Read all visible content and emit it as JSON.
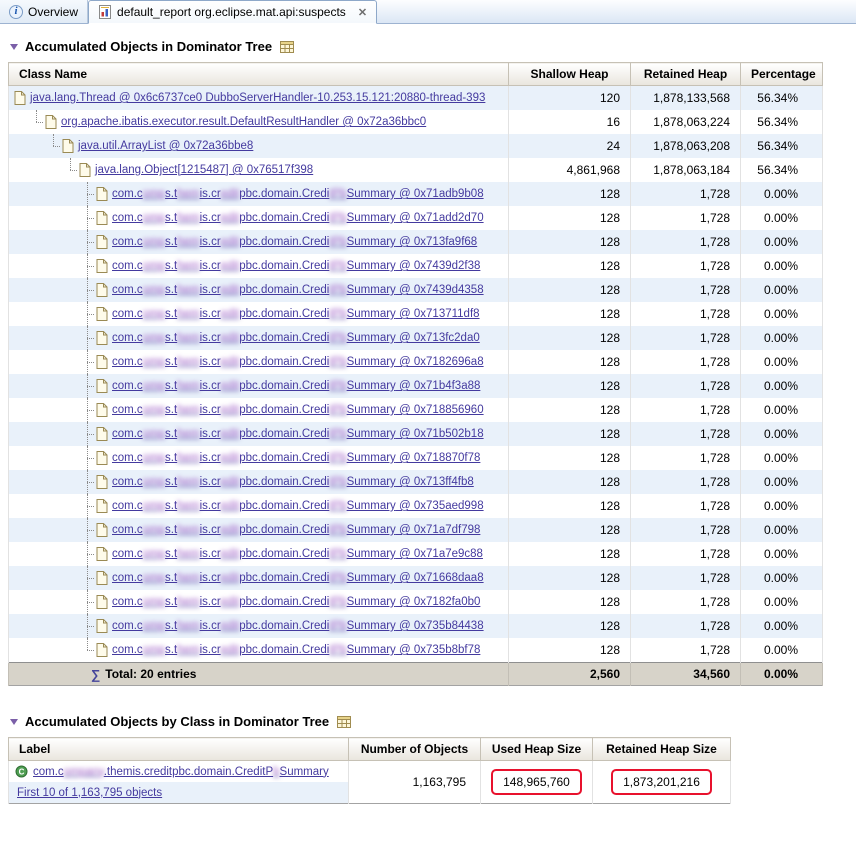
{
  "colors": {
    "link": "#443a9f",
    "redacted": "#9b58c4",
    "annotation_red": "#e8112d",
    "row_alt": "#e9f1fa",
    "total_bg": "#d7d3c9"
  },
  "tabs": [
    {
      "label": "Overview",
      "icon": "info-icon"
    },
    {
      "label": "default_report org.eclipse.mat.api:suspects",
      "icon": "report-icon",
      "active": true,
      "closable": true
    }
  ],
  "dominator_tree": {
    "title": "Accumulated Objects in Dominator Tree",
    "columns": [
      "Class Name",
      "Shallow Heap",
      "Retained Heap",
      "Percentage"
    ],
    "redacted_class_segments": [
      {
        "text": "com.c"
      },
      {
        "text": "omp",
        "redacted": true
      },
      {
        "text": "s.t"
      },
      {
        "text": "hem",
        "redacted": true
      },
      {
        "text": "is.cr"
      },
      {
        "text": "edit",
        "redacted": true
      },
      {
        "text": "pbc.domain.Credi"
      },
      {
        "text": "tPb",
        "redacted": true
      },
      {
        "text": "Summary"
      }
    ],
    "rows": [
      {
        "level": 0,
        "name": "java.lang.Thread @ 0x6c6737ce0 DubboServerHandler-10.253.15.121:20880-thread-393",
        "shallow": "120",
        "retained": "1,878,133,568",
        "percentage": "56.34%"
      },
      {
        "level": 1,
        "name": "org.apache.ibatis.executor.result.DefaultResultHandler @ 0x72a36bbc0",
        "shallow": "16",
        "retained": "1,878,063,224",
        "percentage": "56.34%"
      },
      {
        "level": 2,
        "name": "java.util.ArrayList @ 0x72a36bbe8",
        "shallow": "24",
        "retained": "1,878,063,208",
        "percentage": "56.34%"
      },
      {
        "level": 3,
        "name": "java.lang.Object[1215487] @ 0x76517f398",
        "shallow": "4,861,968",
        "retained": "1,878,063,184",
        "percentage": "56.34%"
      },
      {
        "level": 4,
        "redacted": true,
        "address": "0x71adb9b08",
        "shallow": "128",
        "retained": "1,728",
        "percentage": "0.00%"
      },
      {
        "level": 4,
        "redacted": true,
        "address": "0x71add2d70",
        "shallow": "128",
        "retained": "1,728",
        "percentage": "0.00%"
      },
      {
        "level": 4,
        "redacted": true,
        "address": "0x713fa9f68",
        "shallow": "128",
        "retained": "1,728",
        "percentage": "0.00%"
      },
      {
        "level": 4,
        "redacted": true,
        "address": "0x7439d2f38",
        "shallow": "128",
        "retained": "1,728",
        "percentage": "0.00%"
      },
      {
        "level": 4,
        "redacted": true,
        "address": "0x7439d4358",
        "shallow": "128",
        "retained": "1,728",
        "percentage": "0.00%"
      },
      {
        "level": 4,
        "redacted": true,
        "address": "0x713711df8",
        "shallow": "128",
        "retained": "1,728",
        "percentage": "0.00%"
      },
      {
        "level": 4,
        "redacted": true,
        "address": "0x713fc2da0",
        "shallow": "128",
        "retained": "1,728",
        "percentage": "0.00%"
      },
      {
        "level": 4,
        "redacted": true,
        "address": "0x7182696a8",
        "shallow": "128",
        "retained": "1,728",
        "percentage": "0.00%"
      },
      {
        "level": 4,
        "redacted": true,
        "address": "0x71b4f3a88",
        "shallow": "128",
        "retained": "1,728",
        "percentage": "0.00%"
      },
      {
        "level": 4,
        "redacted": true,
        "address": "0x718856960",
        "shallow": "128",
        "retained": "1,728",
        "percentage": "0.00%"
      },
      {
        "level": 4,
        "redacted": true,
        "address": "0x71b502b18",
        "shallow": "128",
        "retained": "1,728",
        "percentage": "0.00%"
      },
      {
        "level": 4,
        "redacted": true,
        "address": "0x718870f78",
        "shallow": "128",
        "retained": "1,728",
        "percentage": "0.00%"
      },
      {
        "level": 4,
        "redacted": true,
        "address": "0x713ff4fb8",
        "shallow": "128",
        "retained": "1,728",
        "percentage": "0.00%"
      },
      {
        "level": 4,
        "redacted": true,
        "address": "0x735aed998",
        "shallow": "128",
        "retained": "1,728",
        "percentage": "0.00%"
      },
      {
        "level": 4,
        "redacted": true,
        "address": "0x71a7df798",
        "shallow": "128",
        "retained": "1,728",
        "percentage": "0.00%"
      },
      {
        "level": 4,
        "redacted": true,
        "address": "0x71a7e9c88",
        "shallow": "128",
        "retained": "1,728",
        "percentage": "0.00%"
      },
      {
        "level": 4,
        "redacted": true,
        "address": "0x71668daa8",
        "shallow": "128",
        "retained": "1,728",
        "percentage": "0.00%"
      },
      {
        "level": 4,
        "redacted": true,
        "address": "0x7182fa0b0",
        "shallow": "128",
        "retained": "1,728",
        "percentage": "0.00%"
      },
      {
        "level": 4,
        "redacted": true,
        "address": "0x735b84438",
        "shallow": "128",
        "retained": "1,728",
        "percentage": "0.00%"
      },
      {
        "level": 4,
        "redacted": true,
        "address": "0x735b8bf78",
        "shallow": "128",
        "retained": "1,728",
        "percentage": "0.00%"
      }
    ],
    "total": {
      "label": "Total: 20 entries",
      "shallow": "2,560",
      "retained": "34,560",
      "percentage": "0.00%"
    }
  },
  "by_class": {
    "title": "Accumulated Objects by Class in Dominator Tree",
    "columns": [
      "Label",
      "Number of Objects",
      "Used Heap Size",
      "Retained Heap Size"
    ],
    "row": {
      "label_segments": [
        {
          "text": "com.c"
        },
        {
          "text": "ompany",
          "redacted": true
        },
        {
          "text": ".themis.creditpbc.domain.CreditP"
        },
        {
          "text": "b",
          "redacted": true
        },
        {
          "text": "Summary"
        }
      ],
      "sub_link": "First 10 of 1,163,795 objects",
      "objects": "1,163,795",
      "used_heap": "148,965,760",
      "retained_heap": "1,873,201,216"
    }
  }
}
